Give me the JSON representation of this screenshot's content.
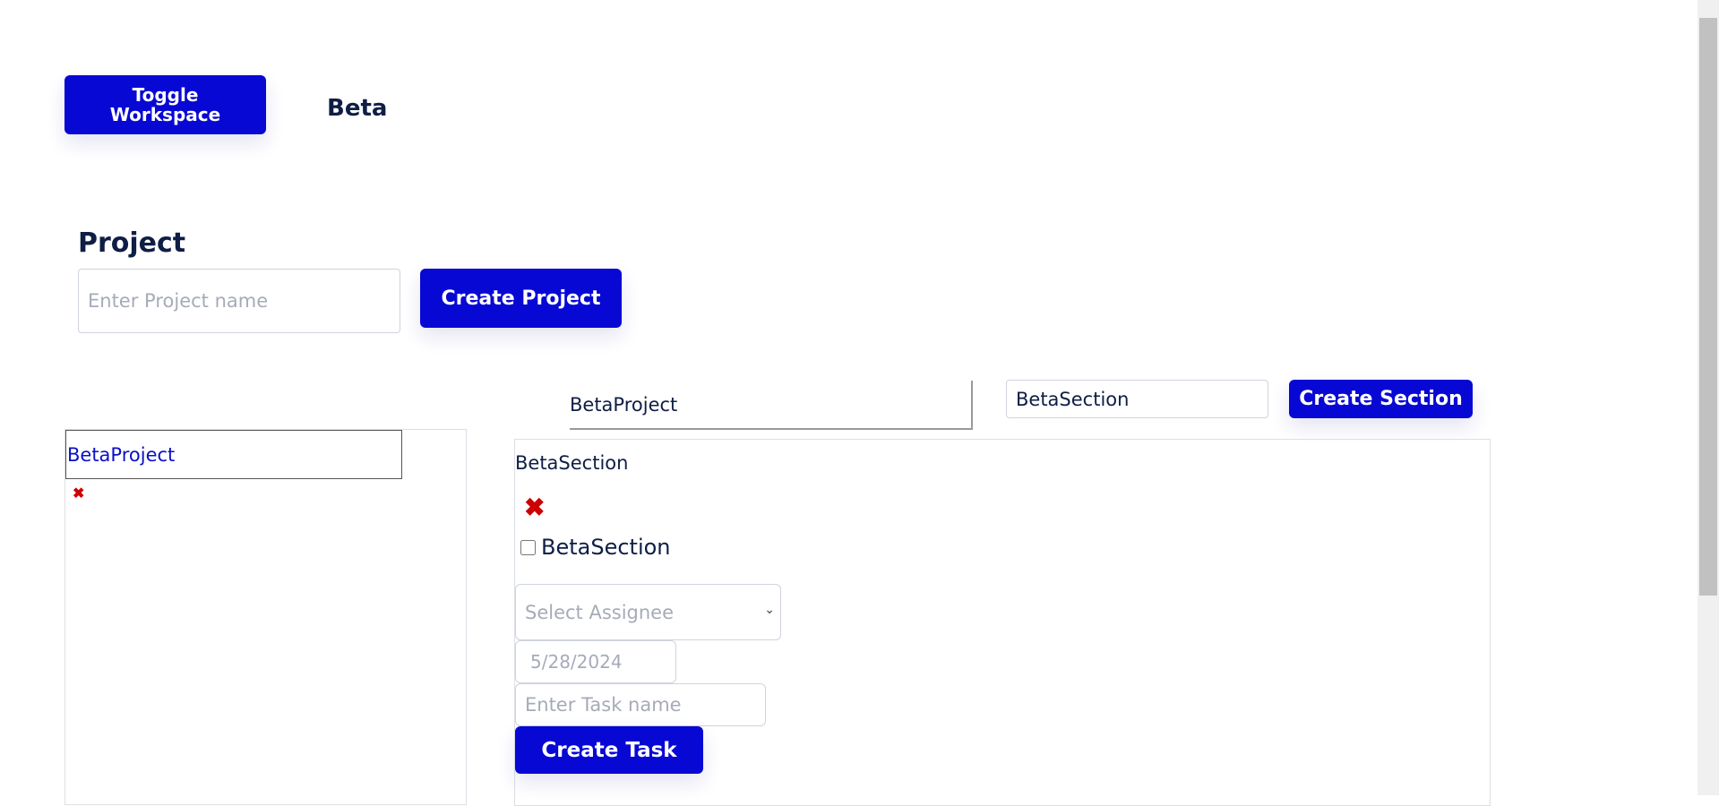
{
  "header": {
    "toggle_label": "Toggle Workspace",
    "workspace_name": "Beta"
  },
  "project": {
    "heading": "Project",
    "input_placeholder": "Enter Project name",
    "input_value": "",
    "create_label": "Create Project",
    "selected_project": "BetaProject",
    "list": [
      {
        "name": "BetaProject",
        "delete_icon": "close-icon"
      }
    ]
  },
  "section": {
    "input_value": "BetaSection",
    "create_label": "Create Section",
    "title": "BetaSection",
    "delete_icon": "close-icon",
    "checkbox_label": "BetaSection",
    "checkbox_checked": false
  },
  "task": {
    "assignee_placeholder": "Select Assignee",
    "due_date": "5/28/2024",
    "name_placeholder": "Enter Task name",
    "create_label": "Create Task"
  },
  "colors": {
    "primary": "#0808d4",
    "text": "#0f1e45",
    "danger": "#cc0000",
    "link": "#0b10c8"
  }
}
